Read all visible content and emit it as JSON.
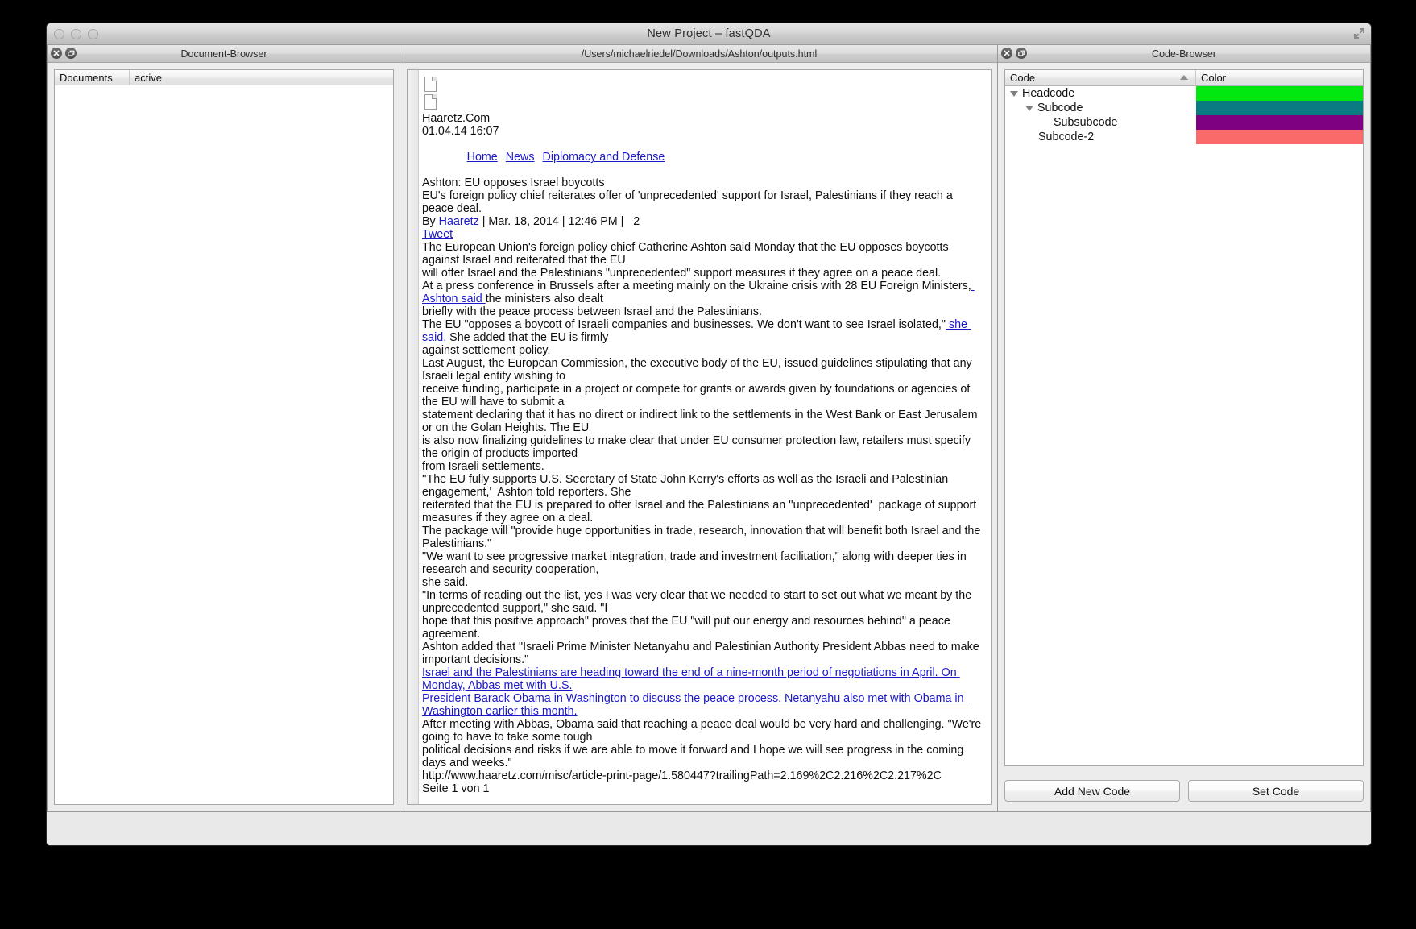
{
  "window": {
    "title": "New Project – fastQDA",
    "fullscreen_icon": "fullscreen-expand-icon"
  },
  "document_browser": {
    "title": "Document-Browser",
    "close_icon": "close-icon",
    "restore_icon": "restore-icon",
    "columns": [
      "Documents",
      "active"
    ],
    "rows": []
  },
  "document_view": {
    "title": "/Users/michaelriedel/Downloads/Ashton/outputs.html",
    "close_icon": "close-icon",
    "restore_icon": "restore-icon",
    "page": {
      "source": "Haaretz.Com",
      "timestamp": "01.04.14 16:07",
      "breadcrumb": [
        "Home",
        "News",
        "Diplomacy and Defense"
      ],
      "headline": "Ashton: EU opposes Israel boycotts",
      "standfirst": "EU's foreign policy chief reiterates offer of 'unprecedented' support for Israel, Palestinians if they reach a peace deal.",
      "byline_prefix": "By",
      "byline_author": "Haaretz",
      "byline_rest": "| Mar. 18, 2014 | 12:46 PM |   2",
      "share_link": "Tweet",
      "body_lines": [
        "The European Union's foreign policy chief Catherine Ashton said Monday that the EU opposes boycotts against Israel and reiterated that the EU",
        "will offer Israel and the Palestinians \"unprecedented\" support measures if they agree on a peace deal."
      ],
      "line_press_a": "At a press conference in Brussels after a meeting mainly on the Ukraine crisis with 28 EU Foreign Ministers,",
      "line_press_link": " Ashton said ",
      "line_press_b": "the ministers also dealt",
      "line_briefly": "briefly with the peace process between Israel and the Palestinians.",
      "line_eu_a": "The EU \"opposes a boycott of Israeli companies and businesses. We don't want to see Israel isolated,\"",
      "line_eu_link": " she said. ",
      "line_eu_b": "She added that the EU is firmly",
      "line_against": "against settlement policy.",
      "body_lines_2": [
        "Last August, the European Commission, the executive body of the EU, issued guidelines stipulating that any Israeli legal entity wishing to",
        "receive funding, participate in a project or compete for grants or awards given by foundations or agencies of the EU will have to submit a",
        "statement declaring that it has no direct or indirect link to the settlements in the West Bank or East Jerusalem or on the Golan Heights. The EU",
        "is also now finalizing guidelines to make clear that under EU consumer protection law, retailers must specify the origin of products imported",
        "from Israeli settlements.",
        "''The EU fully supports U.S. Secretary of State John Kerry's efforts as well as the Israeli and Palestinian engagement,'  Ashton told reporters. She",
        "reiterated that the EU is prepared to offer Israel and the Palestinians an ''unprecedented'  package of support measures if they agree on a deal.",
        "The package will \"provide huge opportunities in trade, research, innovation that will benefit both Israel and the Palestinians.\"",
        "\"We want to see progressive market integration, trade and investment facilitation,\" along with deeper ties in research and security cooperation,",
        "she said.",
        "\"In terms of reading out the list, yes I was very clear that we needed to start to set out what we meant by the unprecedented support,\" she said. \"I",
        "hope that this positive approach\" proves that the EU \"will put our energy and resources behind\" a peace agreement.",
        "Ashton added that \"Israeli Prime Minister Netanyahu and Palestinian Authority President Abbas need to make important decisions.\""
      ],
      "coded_lines": [
        "Israel and the Palestinians are heading toward the end of a nine-month period of negotiations in April. On Monday, Abbas met with U.S.",
        "President Barack Obama in Washington to discuss the peace process. Netanyahu also met with Obama in Washington earlier this month."
      ],
      "body_lines_3": [
        "After meeting with Abbas, Obama said that reaching a peace deal would be very hard and challenging. \"We're going to have to take some tough",
        "political decisions and risks if we are able to move it forward and I hope we will see progress in the coming days and weeks.\""
      ],
      "footer_url": "http://www.haaretz.com/misc/article-print-page/1.580447?trailingPath=2.169%2C2.216%2C2.217%2C",
      "footer_page": "Seite 1 von 1"
    }
  },
  "code_browser": {
    "title": "Code-Browser",
    "close_icon": "close-icon",
    "restore_icon": "restore-icon",
    "columns": [
      "Code",
      "Color"
    ],
    "tree": [
      {
        "label": "Headcode",
        "depth": 0,
        "expandable": true,
        "color": "#00e810"
      },
      {
        "label": "Subcode",
        "depth": 1,
        "expandable": true,
        "color": "#0a7b80"
      },
      {
        "label": "Subsubcode",
        "depth": 2,
        "expandable": false,
        "color": "#7d0180"
      },
      {
        "label": "Subcode-2",
        "depth": 1,
        "expandable": false,
        "color": "#fa6a6a"
      }
    ],
    "buttons": {
      "add_new_code": "Add New Code",
      "set_code": "Set Code"
    }
  }
}
